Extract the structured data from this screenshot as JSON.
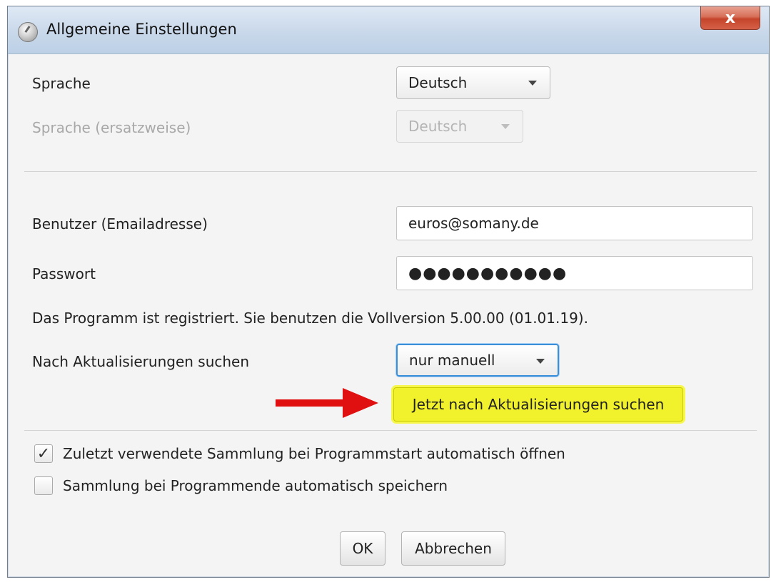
{
  "window": {
    "title": "Allgemeine Einstellungen",
    "close_glyph": "x"
  },
  "language": {
    "label": "Sprache",
    "value": "Deutsch",
    "fallback_label": "Sprache (ersatzweise)",
    "fallback_value": "Deutsch"
  },
  "account": {
    "user_label": "Benutzer (Emailadresse)",
    "user_value": "euros@somany.de",
    "password_label": "Passwort",
    "password_value": "●●●●●●●●●●●"
  },
  "registration_text": "Das Programm ist registriert. Sie benutzen die Vollversion 5.00.00 (01.01.19).",
  "updates": {
    "label": "Nach Aktualisierungen suchen",
    "value": "nur manuell",
    "check_button": "Jetzt nach Aktualisierungen suchen"
  },
  "options": [
    {
      "label": "Zuletzt verwendete Sammlung bei Programmstart automatisch öffnen",
      "checked": true
    },
    {
      "label": "Sammlung bei Programmende automatisch speichern",
      "checked": false
    }
  ],
  "checkmark_glyph": "✓",
  "buttons": {
    "ok": "OK",
    "cancel": "Abbrechen"
  },
  "colors": {
    "highlight": "#f2f22c",
    "annotation_arrow": "#e01010",
    "focus": "#3a8fd8"
  },
  "icons": {
    "app": "app-icon",
    "close": "close-icon",
    "dropdown": "chevron-down-icon",
    "annotation": "red-arrow-icon"
  }
}
